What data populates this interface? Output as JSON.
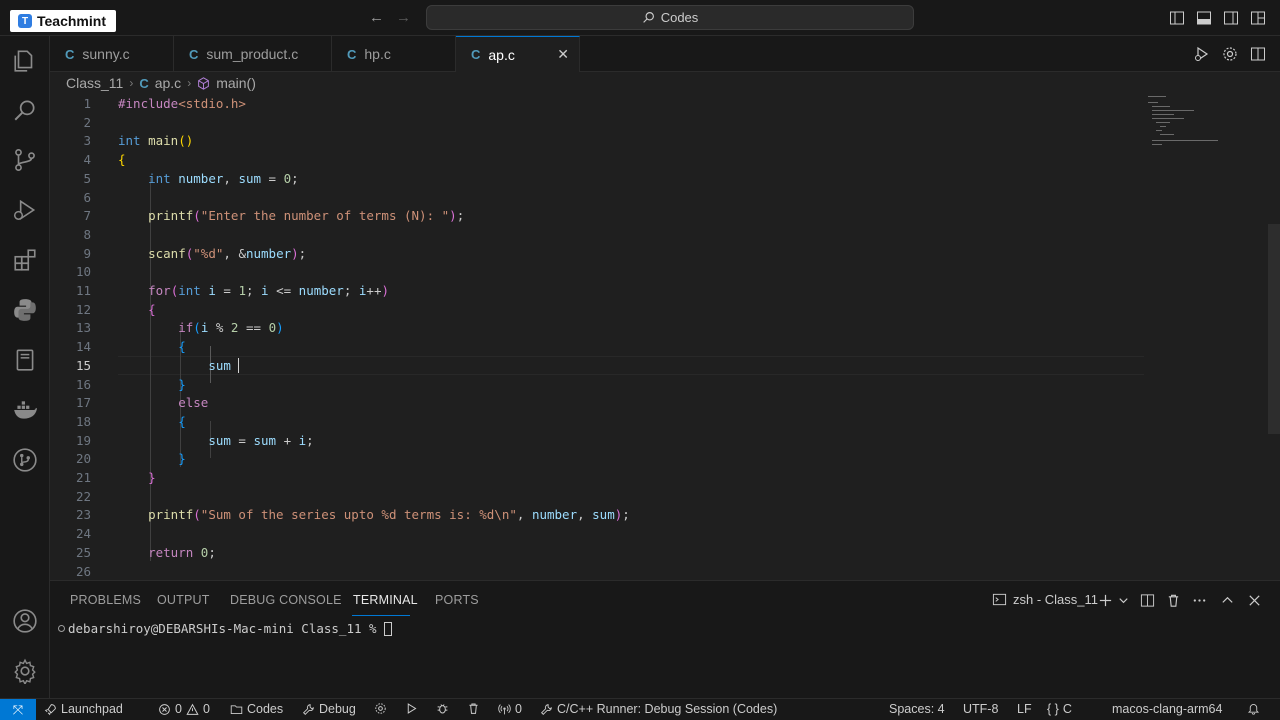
{
  "titlebar": {
    "logo_text": "Teachmint",
    "search_text": "Codes"
  },
  "tabs": [
    {
      "label": "sunny.c",
      "active": false
    },
    {
      "label": "sum_product.c",
      "active": false
    },
    {
      "label": "hp.c",
      "active": false
    },
    {
      "label": "ap.c",
      "active": true
    }
  ],
  "file_icon_glyph": "C",
  "close_glyph": "✕",
  "breadcrumb": {
    "folder": "Class_11",
    "file": "ap.c",
    "symbol": "main()"
  },
  "editor": {
    "current_line": 15,
    "line_numbers": [
      "1",
      "2",
      "3",
      "4",
      "5",
      "6",
      "7",
      "8",
      "9",
      "10",
      "11",
      "12",
      "13",
      "14",
      "15",
      "16",
      "17",
      "18",
      "19",
      "20",
      "21",
      "22",
      "23",
      "24",
      "25",
      "26"
    ],
    "lines": [
      "#include<stdio.h>",
      "",
      "int main()",
      "{",
      "    int number, sum = 0;",
      "",
      "    printf(\"Enter the number of terms (N): \");",
      "",
      "    scanf(\"%d\", &number);",
      "",
      "    for(int i = 1; i <= number; i++)",
      "    {",
      "        if(i % 2 == 0)",
      "        {",
      "            sum ",
      "        }",
      "        else",
      "        {",
      "            sum = sum + i;",
      "        }",
      "    }",
      "",
      "    printf(\"Sum of the series upto %d terms is: %d\\n\", number, sum);",
      "",
      "    return 0;",
      ""
    ]
  },
  "panel": {
    "tabs": [
      "PROBLEMS",
      "OUTPUT",
      "DEBUG CONSOLE",
      "TERMINAL",
      "PORTS"
    ],
    "active_tab": "TERMINAL",
    "terminal_name": "zsh - Class_11",
    "prompt": "debarshiroy@DEBARSHIs-Mac-mini Class_11 % "
  },
  "statusbar": {
    "launchpad": "Launchpad",
    "errors": "0",
    "warnings": "0",
    "folder": "Codes",
    "debug": "Debug",
    "ports": "0",
    "runner": "C/C++ Runner: Debug Session (Codes)",
    "spaces": "Spaces: 4",
    "encoding": "UTF-8",
    "eol": "LF",
    "language": "C",
    "config": "macos-clang-arm64"
  },
  "colors": {
    "accent": "#0078d4",
    "keyword": "#569cd6",
    "control": "#c586c0",
    "function": "#dcdcaa",
    "string": "#ce9178",
    "number": "#b5cea8",
    "variable": "#9cdcfe"
  }
}
